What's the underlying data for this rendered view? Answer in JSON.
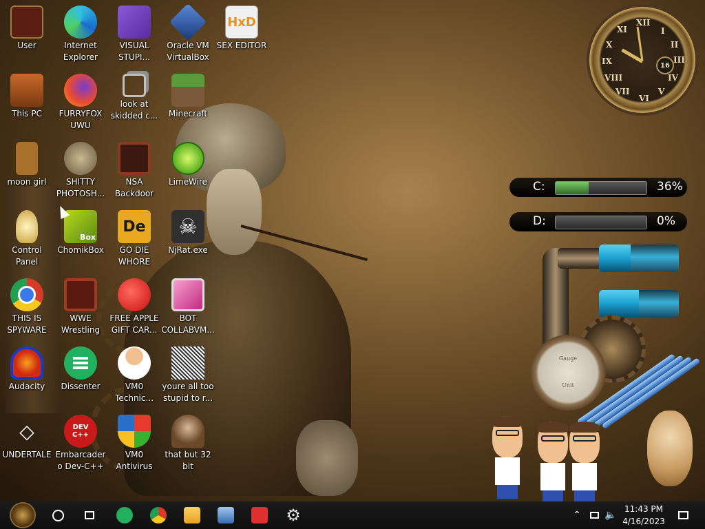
{
  "desktop": {
    "icons": [
      {
        "label": "User",
        "icon": "user-folder-icon",
        "color": "#7a2a1a"
      },
      {
        "label": "Internet Explorer",
        "icon": "edge-icon",
        "color": "#1a8ad4"
      },
      {
        "label": "VISUAL STUPI...",
        "icon": "visual-studio-icon",
        "color": "#6a3aa8"
      },
      {
        "label": "Oracle VM VirtualBox",
        "icon": "virtualbox-icon",
        "color": "#2a4a88"
      },
      {
        "label": "SEX EDITOR",
        "icon": "hxd-icon",
        "color": "#e8e8e8"
      },
      {
        "label": "This PC",
        "icon": "computer-icon",
        "color": "#a04a1a"
      },
      {
        "label": "FURRYFOX UWU",
        "icon": "firefox-icon",
        "color": "#e85a20"
      },
      {
        "label": "look at skidded c...",
        "icon": "stacked-windows-icon",
        "color": "#9a9a9a"
      },
      {
        "label": "Minecraft",
        "icon": "minecraft-block-icon",
        "color": "#4a7a3a"
      },
      {
        "label": "moon girl",
        "icon": "book-icon",
        "color": "#a86a2a"
      },
      {
        "label": "SHITTY PHOTOSH...",
        "icon": "gimp-icon",
        "color": "#8a8070"
      },
      {
        "label": "NSA Backdoor",
        "icon": "window-frame-icon",
        "color": "#5a2a1a"
      },
      {
        "label": "LimeWire",
        "icon": "lime-icon",
        "color": "#6ac82a"
      },
      {
        "label": "Control Panel",
        "icon": "lightbulb-icon",
        "color": "#d8c070"
      },
      {
        "label": "ChomikBox",
        "icon": "hamster-box-icon",
        "color": "#8ac020"
      },
      {
        "label": "GO DIE WHORE",
        "icon": "de-letters-icon",
        "color": "#e8a820"
      },
      {
        "label": "NjRat.exe",
        "icon": "skull-icon",
        "color": "#303030"
      },
      {
        "label": "THIS IS SPYWARE",
        "icon": "chrome-icon",
        "color": "#d83a2a"
      },
      {
        "label": "WWE Wrestling",
        "icon": "tv-icon",
        "color": "#7a2a1a"
      },
      {
        "label": "FREE APPLE GIFT CAR...",
        "icon": "apple-icon",
        "color": "#d81a1a"
      },
      {
        "label": "BOT COLLABVM...",
        "icon": "monitor-pink-icon",
        "color": "#d850a0"
      },
      {
        "label": "Audacity",
        "icon": "audacity-icon",
        "color": "#1a3ac8"
      },
      {
        "label": "Dissenter",
        "icon": "dissenter-icon",
        "color": "#20b060"
      },
      {
        "label": "VM0 Technic...",
        "icon": "technician-icon",
        "color": "#e8e8e8"
      },
      {
        "label": "youre all too stupid to r...",
        "icon": "portrait-icon",
        "color": "#d0d0d0"
      },
      {
        "label": "UNDERTALE",
        "icon": "unity-icon",
        "color": "#303030"
      },
      {
        "label": "Embarcadero Dev-C++",
        "icon": "devcpp-icon",
        "color": "#c81a1a"
      },
      {
        "label": "VM0 Antivirus",
        "icon": "shield-icon",
        "color": "#2a70c8"
      },
      {
        "label": "that but 32 bit",
        "icon": "portrait-painting-icon",
        "color": "#8a6a4a"
      }
    ],
    "icon_glyphs": {
      "devcpp": "DEV C++",
      "hxd": "HxD",
      "de": "De",
      "box": "Box"
    }
  },
  "widgets": {
    "clock": {
      "numerals": [
        "XII",
        "I",
        "II",
        "III",
        "IV",
        "V",
        "VI",
        "VII",
        "VIII",
        "IX",
        "X",
        "XI"
      ],
      "date_day": "16"
    },
    "drives": [
      {
        "letter": "C:",
        "percent_text": "36%",
        "used_fraction": 0.36
      },
      {
        "letter": "D:",
        "percent_text": "0%",
        "used_fraction": 0.0
      }
    ],
    "tubes": [
      {
        "level_fraction": 0.4
      },
      {
        "level_fraction": 0.5
      }
    ],
    "gauge": {
      "line1": "Gauge",
      "line2": "Unit"
    }
  },
  "taskbar": {
    "start": {
      "icon": "steampunk-start-orb-icon"
    },
    "pinned": [
      {
        "name": "dissenter",
        "icon": "dissenter-icon",
        "color": "#20b060"
      },
      {
        "name": "chrome",
        "icon": "chrome-icon",
        "color": "#d83a2a"
      },
      {
        "name": "file-explorer",
        "icon": "folder-icon",
        "color": "#e8b030"
      },
      {
        "name": "network-app",
        "icon": "network-computer-icon",
        "color": "#5a8ad0"
      },
      {
        "name": "anydesk",
        "icon": "anydesk-icon",
        "color": "#e03030"
      },
      {
        "name": "settings",
        "icon": "gear-icon",
        "color": "#d0d0d0"
      }
    ],
    "tray": {
      "time": "11:43 PM",
      "date": "4/16/2023"
    }
  }
}
